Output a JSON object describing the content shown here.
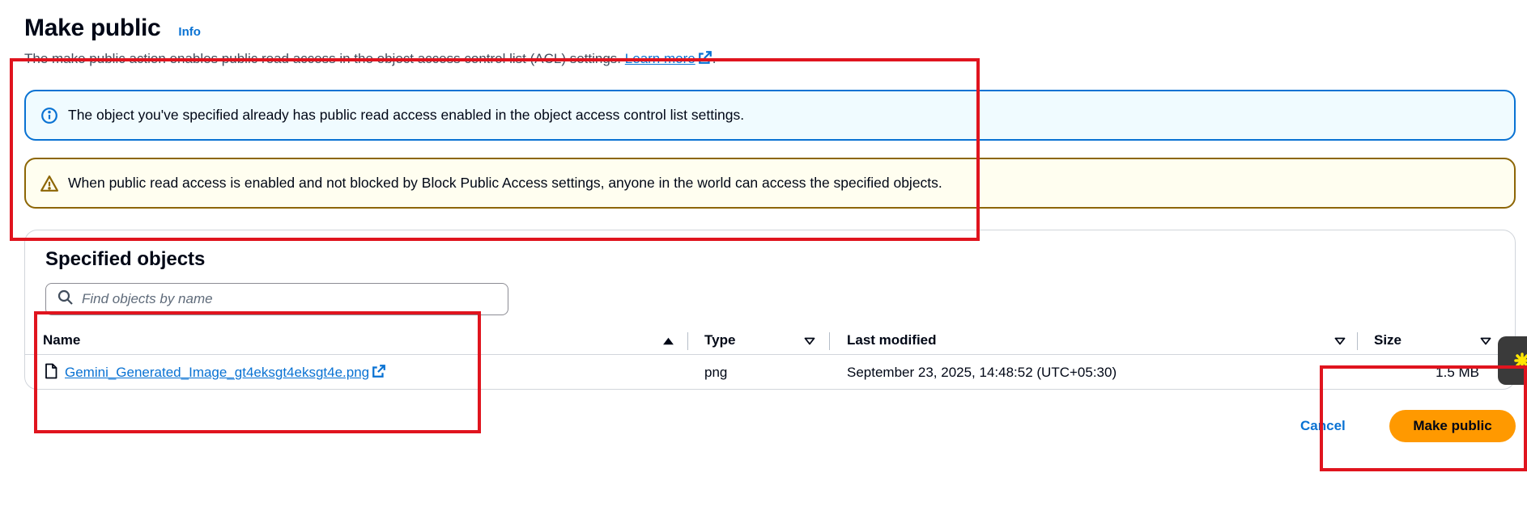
{
  "header": {
    "title": "Make public",
    "info_label": "Info",
    "description": "The make public action enables public read access in the object access control list (ACL) settings.",
    "learn_more_label": "Learn more",
    "learn_more_suffix": "."
  },
  "alerts": {
    "info": {
      "icon": "info-circle-icon",
      "text": "The object you've specified already has public read access enabled in the object access control list settings."
    },
    "warning": {
      "icon": "warning-triangle-icon",
      "text": "When public read access is enabled and not blocked by Block Public Access settings, anyone in the world can access the specified objects."
    }
  },
  "objects": {
    "title": "Specified objects",
    "search": {
      "placeholder": "Find objects by name",
      "value": ""
    },
    "columns": {
      "name": "Name",
      "type": "Type",
      "last_modified": "Last modified",
      "size": "Size"
    },
    "rows": [
      {
        "name": "Gemini_Generated_Image_gt4eksgt4eksgt4e.png",
        "type": "png",
        "last_modified": "September 23, 2025, 14:48:52 (UTC+05:30)",
        "size": "1.5 MB"
      }
    ]
  },
  "footer": {
    "cancel_label": "Cancel",
    "submit_label": "Make public"
  },
  "colors": {
    "link": "#0972d3",
    "primary_button": "#ff9900",
    "info_border": "#0972d3",
    "warning_border": "#8d6605",
    "annotation": "#e0141e"
  }
}
